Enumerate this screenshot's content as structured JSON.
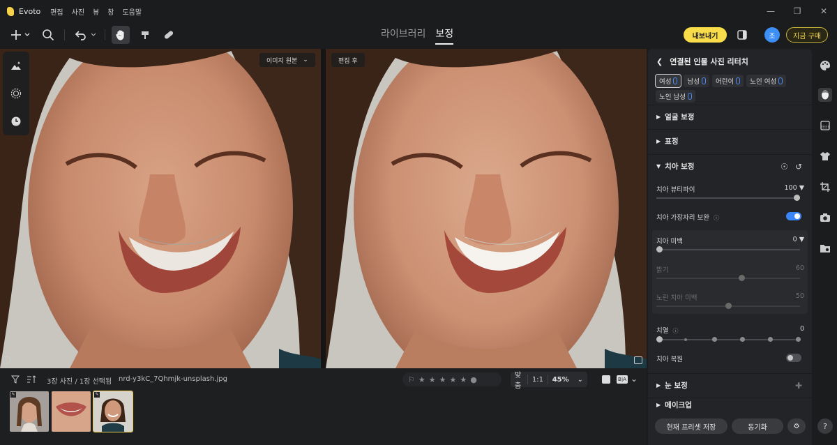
{
  "titlebar": {
    "app_name": "Evoto",
    "menus": [
      "편집",
      "사진",
      "뷰",
      "창",
      "도움말"
    ]
  },
  "toolbar": {
    "tabs": [
      {
        "label": "라이브러리",
        "active": false
      },
      {
        "label": "보정",
        "active": true
      }
    ],
    "export_label": "내보내기",
    "avatar_initial": "조",
    "buy_label": "지금 구매"
  },
  "canvas": {
    "original_label": "이미지 원본",
    "edited_label": "편집 후"
  },
  "bottom": {
    "count_text": "3장 사진 / 1장 선택됨",
    "file_name": "nrd-y3kC_7Qhmjk-unsplash.jpg",
    "zoom_fit": "맞춤",
    "zoom_one": "1:1",
    "zoom_value": "45%",
    "view_mode": "B|A",
    "selected_thumb": 2
  },
  "panel": {
    "header": "연결된 인물 사진 리터치",
    "chips": [
      {
        "label": "여성",
        "active": true
      },
      {
        "label": "남성",
        "active": false
      },
      {
        "label": "어린이",
        "active": false
      },
      {
        "label": "노인 여성",
        "active": false
      },
      {
        "label": "노인 남성",
        "active": false
      }
    ],
    "sections": {
      "face": "얼굴 보정",
      "expression": "표정",
      "teeth": "치아 보정",
      "eyes": "눈 보정",
      "makeup": "메이크업"
    },
    "teeth": {
      "beautify_label": "치아 뷰티파이",
      "beautify_value": "100",
      "beautify_fraction": 1.0,
      "edge_label": "치아 가장자리 보완",
      "edge_on": true,
      "whiten_label": "치아 미백",
      "whiten_value": "0",
      "whiten_fraction": 0.0,
      "brightness_label": "밝기",
      "brightness_value": "60",
      "brightness_fraction": 0.6,
      "yellow_label": "노란 치아 미백",
      "yellow_value": "50",
      "yellow_fraction": 0.5,
      "alignment_label": "치열",
      "alignment_value": "0",
      "restore_label": "치아 복원",
      "restore_on": false
    },
    "footer": {
      "save_preset": "현재 프리셋 저장",
      "sync": "동기화"
    }
  },
  "colors": {
    "accent_yellow": "#f9dc4a",
    "accent_blue": "#3a86f6"
  }
}
